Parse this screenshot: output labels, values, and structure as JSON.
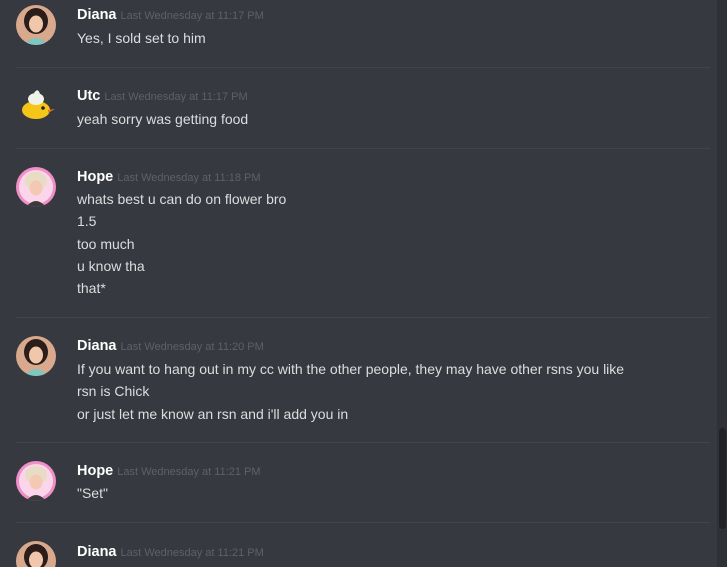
{
  "messages": [
    {
      "author": "Diana",
      "timestamp": "Last Wednesday at 11:17 PM",
      "avatar_icon": "woman-portrait-avatar",
      "lines": [
        "Yes, I sold set to him"
      ]
    },
    {
      "author": "Utc",
      "timestamp": "Last Wednesday at 11:17 PM",
      "avatar_icon": "ice-cream-bird-avatar",
      "lines": [
        "yeah sorry was getting food"
      ]
    },
    {
      "author": "Hope",
      "timestamp": "Last Wednesday at 11:18 PM",
      "avatar_icon": "blonde-person-avatar",
      "lines": [
        "whats best u can do on flower bro",
        "1.5",
        "too much",
        "u know tha",
        "that*"
      ]
    },
    {
      "author": "Diana",
      "timestamp": "Last Wednesday at 11:20 PM",
      "avatar_icon": "woman-portrait-avatar",
      "lines": [
        "If you want to hang out in my cc with the other people, they may have other rsns you like",
        "rsn is Chick",
        "or just let me know an rsn and i'll add you in"
      ]
    },
    {
      "author": "Hope",
      "timestamp": "Last Wednesday at 11:21 PM",
      "avatar_icon": "blonde-person-avatar",
      "lines": [
        "\"Set\""
      ]
    },
    {
      "author": "Diana",
      "timestamp": "Last Wednesday at 11:21 PM",
      "avatar_icon": "woman-portrait-avatar",
      "lines": []
    }
  ],
  "colors": {
    "background": "#36393f",
    "author": "#ffffff",
    "timestamp": "#5d6168",
    "message_text": "#dcddde",
    "divider": "#40444b",
    "scrollbar_thumb": "#202225"
  }
}
